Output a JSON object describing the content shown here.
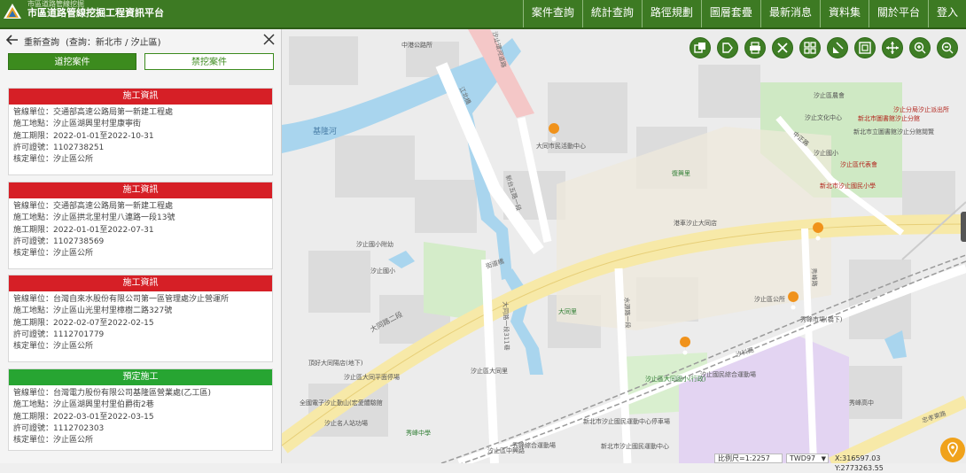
{
  "header": {
    "logo_small_text": "市區道路管線挖掘",
    "title": "市區道路管線挖掘工程資訊平台",
    "nav": [
      "案件查詢",
      "統計查詢",
      "路徑規劃",
      "圖層套疊",
      "最新消息",
      "資料集",
      "關於平台",
      "登入"
    ]
  },
  "panel": {
    "title": "重新查詢",
    "query": "(查詢：新北市 / 汐止區)",
    "tabs": [
      "道挖案件",
      "禁挖案件"
    ],
    "field_labels": [
      "管線單位：",
      "施工地點：",
      "施工期限：",
      "許可證號：",
      "核定單位："
    ],
    "cards": [
      {
        "status": "施工資訊",
        "status_color": "#d61f26",
        "unit": "交通部高速公路局第一新建工程處",
        "location": "汐止區湖興里村里康寧街",
        "period": "2022-01-01至2022-10-31",
        "permit": "1102738251",
        "authority": "汐止區公所"
      },
      {
        "status": "施工資訊",
        "status_color": "#d61f26",
        "unit": "交通部高速公路局第一新建工程處",
        "location": "汐止區拱北里村里八連路一段13號",
        "period": "2022-01-01至2022-07-31",
        "permit": "1102738569",
        "authority": "汐止區公所"
      },
      {
        "status": "施工資訊",
        "status_color": "#d61f26",
        "unit": "台灣自來水股份有限公司第一區管理處汐止營運所",
        "location": "汐止區山光里村里樟樹二路327號",
        "period": "2022-02-07至2022-02-15",
        "permit": "1112701779",
        "authority": "汐止區公所"
      },
      {
        "status": "預定施工",
        "status_color": "#27a532",
        "unit": "台灣電力股份有限公司基隆區營業處(乙工區)",
        "location": "汐止區湖興里村里伯爵街2巷",
        "period": "2022-03-01至2022-03-15",
        "permit": "1112702303",
        "authority": "汐止區公所"
      }
    ]
  },
  "map": {
    "tools": [
      "layers-icon",
      "tag-icon",
      "print-icon",
      "clear-icon",
      "grid-icon",
      "measure-icon",
      "fullscreen-icon",
      "pan-icon",
      "zoom-in-icon",
      "zoom-out-icon"
    ],
    "labels": {
      "river": "基隆河",
      "police": "中港公路所",
      "road_1": "汐止環河道路",
      "road_2": "江北橋",
      "road_3": "大同路二段",
      "road_4": "街道橋",
      "road_5": "大同路一段311巷",
      "road_6": "水源路一段",
      "road_7": "汐科路",
      "road_8": "秀峰路",
      "road_9": "新台五路一段",
      "road_10": "忠孝東路",
      "poi_1": "汐止國小附幼",
      "poi_2": "汐止國小",
      "poi_3": "頂好大同陽店(地下)",
      "poi_4": "汐止區大同平面停場",
      "poi_5": "全國電子汐止勤山(宏愛體驗館",
      "poi_6": "汐止名人站功場",
      "poi_7": "大同市民活動中心",
      "poi_8": "新北市汐止國民運動中心停車場",
      "poi_9": "新北市汐止國民運動中心",
      "poi_10": "秀峰市場(橋下)",
      "poi_11": "汐止區公所",
      "poi_12": "汐止區大同里",
      "poi_13": "汐止國民綜合運動場",
      "poi_14": "汐止區農會",
      "poi_15": "汐止文化中心",
      "poi_16": "新北市圖書館汐止分館",
      "poi_17": "新北市汐止國民小學",
      "poi_18": "汐止分局汐止派出所",
      "poi_19": "新北市立圖書館汐止分館閱覽",
      "poi_20": "汐止區農會",
      "poi_21": "汐止區代表會",
      "poi_22": "秀峰高中",
      "poi_23": "秀峰綜合運動場",
      "poi_24": "復興里",
      "poi_25": "拱北里",
      "poi_26": "大同里",
      "poi_27": "汐止區大同國小(行政)",
      "poi_28": "港車汐止大同店",
      "poi_29": "汐止區中興路",
      "poi_30": "汐止國小",
      "poi_31": "秀峰中學",
      "road_11": "大同路二段",
      "road_12": "中正路",
      "road_13": "新台五路",
      "road_14": "汐止",
      "highway": "國道"
    },
    "scale_label": "比例尺=1:",
    "scale_value": "2257",
    "crs": "TWD97",
    "coords": "X:316597.03 Y:2773263.55"
  }
}
